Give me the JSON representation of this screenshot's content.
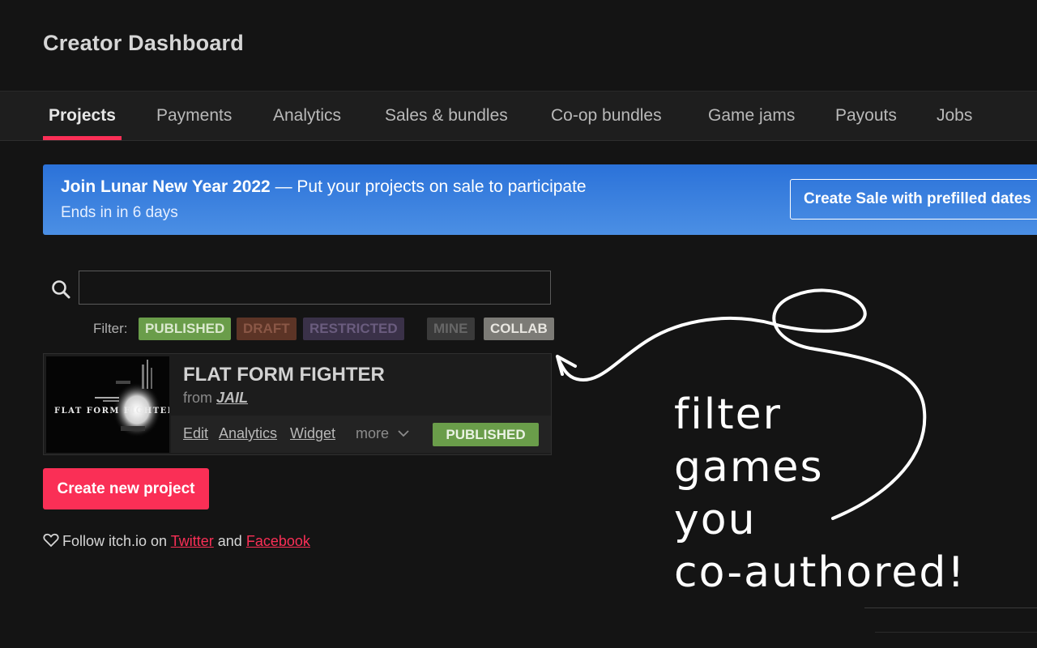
{
  "header": {
    "title": "Creator Dashboard"
  },
  "tabs": [
    {
      "label": "Projects",
      "active": true
    },
    {
      "label": "Payments"
    },
    {
      "label": "Analytics"
    },
    {
      "label": "Sales & bundles"
    },
    {
      "label": "Co-op bundles"
    },
    {
      "label": "Game jams"
    },
    {
      "label": "Payouts"
    },
    {
      "label": "Jobs"
    }
  ],
  "banner": {
    "title": "Join Lunar New Year 2022",
    "message": " — Put your projects on sale to participate",
    "ends": "Ends in in 6 days",
    "button": "Create Sale with prefilled dates"
  },
  "search": {
    "value": "",
    "placeholder": ""
  },
  "filters": {
    "label": "Filter:",
    "chips": [
      "PUBLISHED",
      "DRAFT",
      "RESTRICTED",
      "MINE",
      "COLLAB"
    ]
  },
  "project": {
    "thumbnail_text": "FLAT FORM FIGHTER",
    "title": "FLAT FORM FIGHTER",
    "from_prefix": "from",
    "author": "JAIL",
    "links": [
      "Edit",
      "Analytics",
      "Widget"
    ],
    "more": "more",
    "status": "PUBLISHED"
  },
  "create_button": "Create new project",
  "follow": {
    "prefix": "Follow itch.io on",
    "twitter": "Twitter",
    "and": "and",
    "facebook": "Facebook"
  },
  "annotation": {
    "lines": [
      "filter",
      "games",
      "you",
      "co-authored!"
    ]
  },
  "colors": {
    "accent": "#fa2f56",
    "published": "#6a9d4a",
    "banner_blue": "#2b72d9"
  }
}
